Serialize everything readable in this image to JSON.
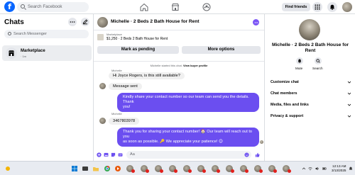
{
  "topbar": {
    "logo": "f",
    "search_placeholder": "Search Facebook",
    "find_friends": "Find friends"
  },
  "left": {
    "title": "Chats",
    "search_placeholder": "Search Messenger",
    "chat": {
      "name": "Marketplace",
      "time": "· 1m"
    }
  },
  "conversation": {
    "title": "Michelle · 2 Beds 2 Bath House for Rent",
    "listing_small": "Marketplace",
    "listing_price": "$1,250 · 2 Beds 2 Bath House for Rent",
    "mark_pending": "Mark as pending",
    "more_options": "More options",
    "system_prefix": "Michelle started this chat.",
    "system_link": "View buyer profile",
    "messages": {
      "m1_sender": "Michelle",
      "m1_text": "Hi Joyce Rogers, is this still available?",
      "m2_text": "Message sent",
      "m3_line1": "Kindly share your contact number so our team can send you the details. Thank",
      "m3_line2": "you!",
      "m4_sender": "Michelle",
      "m4_text": "3467803978",
      "m5_line1": "Thank you for sharing your contact number! 🏠 Our team will reach out to you",
      "m5_line2": "as soon as possible. 🔑 We appreciate your patience! 😊"
    },
    "composer_placeholder": "Aa"
  },
  "right": {
    "name_line1": "Michelle · 2 Beds 2 Bath House for",
    "name_line2": "Rent",
    "mute": "Mute",
    "search": "Search",
    "rows": [
      "Customize chat",
      "Chat members",
      "Media, files and links",
      "Privacy & support"
    ]
  },
  "taskbar": {
    "time": "12:13 AM",
    "date": "3/13/2025"
  },
  "colors": {
    "accent": "#6b4ef0",
    "brand": "#0866ff"
  }
}
